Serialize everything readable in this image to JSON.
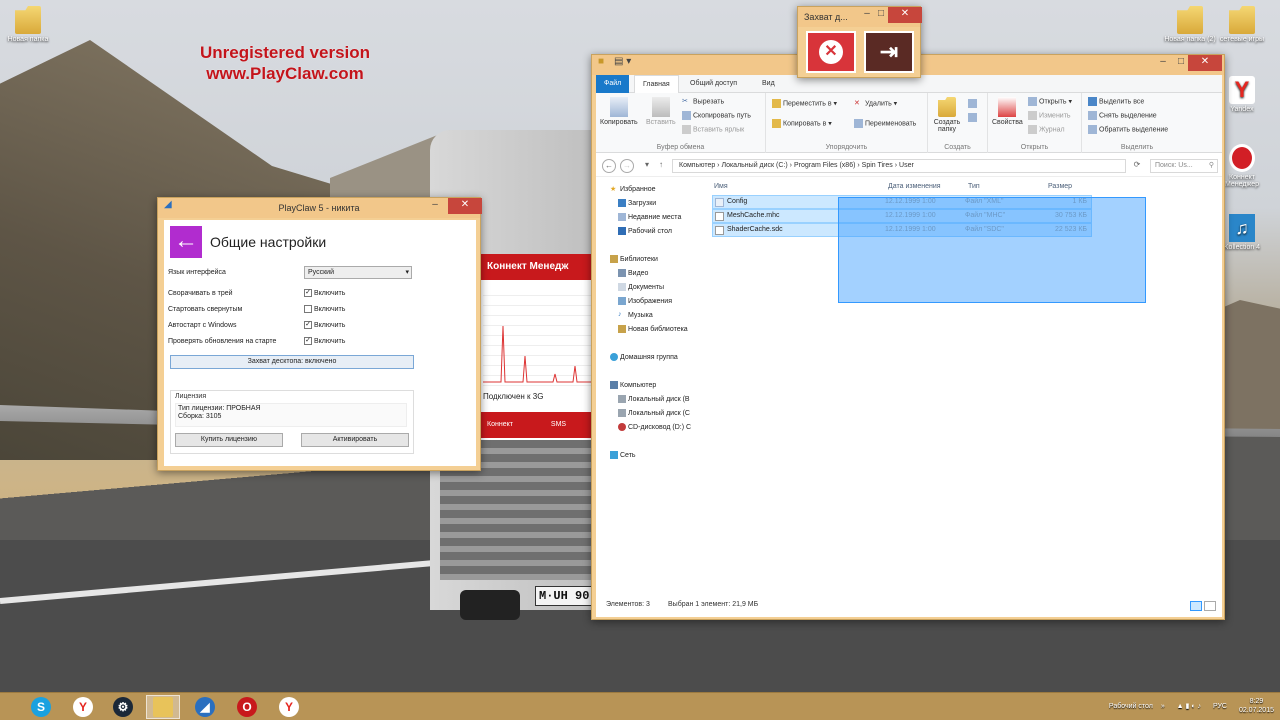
{
  "watermark": {
    "line1": "Unregistered version",
    "line2": "www.PlayClaw.com"
  },
  "plate": "M·UH 90",
  "desktop_icons": [
    {
      "label": "Новая папка"
    },
    {
      "label": "Новая папка (2)"
    },
    {
      "label": "сетевые игры"
    },
    {
      "label": "Yandex"
    },
    {
      "label": "Коннект Менеджер"
    },
    {
      "label": "Kollection 4"
    }
  ],
  "playclaw": {
    "title": "PlayClaw 5 - никита",
    "heading": "Общие настройки",
    "language_label": "Язык интерфейса",
    "language_value": "Русский",
    "rows": [
      {
        "label": "Сворачивать в трей",
        "check": "Включить",
        "checked": true
      },
      {
        "label": "Стартовать свернутым",
        "check": "Включить",
        "checked": false
      },
      {
        "label": "Автостарт с Windows",
        "check": "Включить",
        "checked": true
      },
      {
        "label": "Проверять обновления на старте",
        "check": "Включить",
        "checked": true
      }
    ],
    "capture_button": "Захват десктопа: включено",
    "license_title": "Лицензия",
    "license_type": "Тип лицензии: ПРОБНАЯ",
    "license_build": "Сборка: 3105",
    "buy_button": "Купить лицензию",
    "activate_button": "Активировать"
  },
  "connect_app": {
    "header": "Коннект Менедж",
    "status": "Подключен к 3G",
    "footer_left": "Коннект",
    "footer_right": "SMS"
  },
  "capture_popup": {
    "title": "Захват д..."
  },
  "explorer": {
    "tabs": [
      "Файл",
      "Главная",
      "Общий доступ",
      "Вид"
    ],
    "ribbon": {
      "copy": "Копировать",
      "paste": "Вставить",
      "cut": "Вырезать",
      "copy_path": "Скопировать путь",
      "paste_shortcut": "Вставить ярлык",
      "clipboard_group": "Буфер обмена",
      "move_to": "Переместить в",
      "copy_to": "Копировать в",
      "delete": "Удалить",
      "rename": "Переименовать",
      "organize_group": "Упорядочить",
      "new_folder": "Создать папку",
      "create_group": "Создать",
      "properties": "Свойства",
      "open": "Открыть",
      "edit": "Изменить",
      "history": "Журнал",
      "open_group": "Открыть",
      "select_all": "Выделить все",
      "select_none": "Снять выделение",
      "invert_selection": "Обратить выделение",
      "select_group": "Выделить"
    },
    "breadcrumb": [
      "Компьютер",
      "Локальный диск (C:)",
      "Program Files (x86)",
      "Spin Tires",
      "User"
    ],
    "search_placeholder": "Поиск: Us...",
    "nav": {
      "favorites": "Избранное",
      "downloads": "Загрузки",
      "recent": "Недавние места",
      "desktop": "Рабочий стол",
      "libraries": "Библиотеки",
      "video": "Видео",
      "docs": "Документы",
      "images": "Изображения",
      "music": "Музыка",
      "new_lib": "Новая библиотека",
      "homegroup": "Домашняя группа",
      "computer": "Компьютер",
      "disk_b": "Локальный диск (B",
      "disk_c": "Локальный диск (C",
      "cd": "CD-дисковод (D:) C",
      "network": "Сеть"
    },
    "columns": [
      "Имя",
      "Дата изменения",
      "Тип",
      "Размер"
    ],
    "files": [
      {
        "name": "Config",
        "date": "12.12.1999 1:00",
        "type": "Файл \"XML\"",
        "size": "1 КБ"
      },
      {
        "name": "MeshCache.mhc",
        "date": "12.12.1999 1:00",
        "type": "Файл \"MHC\"",
        "size": "30 753 КБ"
      },
      {
        "name": "ShaderCache.sdc",
        "date": "12.12.1999 1:00",
        "type": "Файл \"SDC\"",
        "size": "22 523 КБ"
      }
    ],
    "status_items": "Элементов: 3",
    "status_selected": "Выбран 1 элемент: 21,9 МБ"
  },
  "taskbar": {
    "desktop_label": "Рабочий стол",
    "lang": "РУС",
    "time": "8:29",
    "date": "02.07.2015"
  },
  "colors": {
    "accent": "#1979ca",
    "title_bar": "#f2c78a",
    "close": "#c7463c",
    "playclaw_purple": "#b12ccf"
  }
}
